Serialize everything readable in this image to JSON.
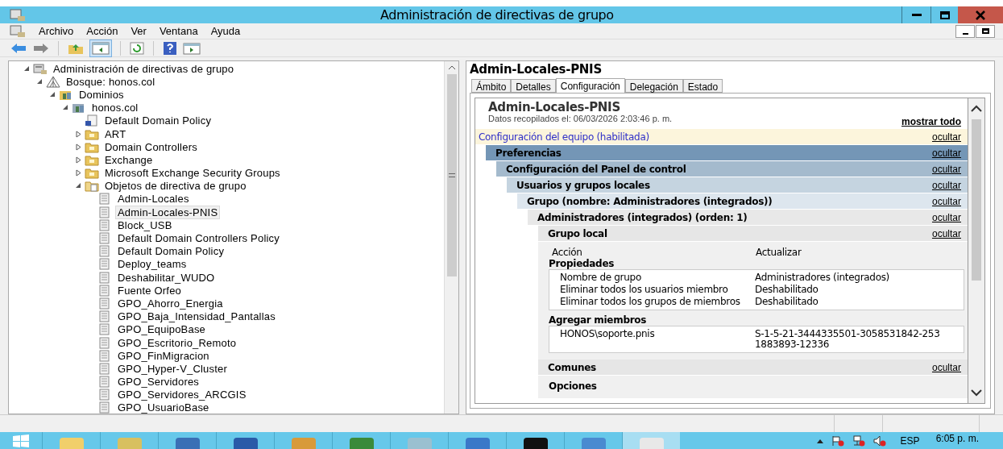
{
  "window": {
    "title": "Administración de directivas de grupo"
  },
  "menu": [
    "Archivo",
    "Acción",
    "Ver",
    "Ventana",
    "Ayuda"
  ],
  "toolbar": [
    {
      "kind": "back"
    },
    {
      "kind": "forward"
    },
    {
      "kind": "sep"
    },
    {
      "kind": "up"
    },
    {
      "kind": "pane",
      "selected": true
    },
    {
      "kind": "sep"
    },
    {
      "kind": "refresh"
    },
    {
      "kind": "sep"
    },
    {
      "kind": "help"
    },
    {
      "kind": "view"
    }
  ],
  "tree": [
    {
      "label": "Administración de directivas de grupo",
      "kind": "console",
      "expanded": true,
      "children": [
        {
          "label": "Bosque: honos.col",
          "kind": "forest",
          "expanded": true,
          "children": [
            {
              "label": "Dominios",
              "kind": "domains",
              "expanded": true,
              "children": [
                {
                  "label": "honos.col",
                  "kind": "domain",
                  "expanded": true,
                  "children": [
                    {
                      "label": "Default Domain Policy",
                      "kind": "link"
                    },
                    {
                      "label": "ART",
                      "kind": "ou",
                      "expanded": false
                    },
                    {
                      "label": "Domain Controllers",
                      "kind": "ou",
                      "expanded": false
                    },
                    {
                      "label": "Exchange",
                      "kind": "ou",
                      "expanded": false
                    },
                    {
                      "label": "Microsoft Exchange Security Groups",
                      "kind": "ou",
                      "expanded": false
                    },
                    {
                      "label": "Objetos de directiva de grupo",
                      "kind": "gpofolder",
                      "expanded": true,
                      "children": [
                        {
                          "label": "Admin-Locales",
                          "kind": "gpo",
                          "selected": false
                        },
                        {
                          "label": "Admin-Locales-PNIS",
                          "kind": "gpo",
                          "selected": true
                        },
                        {
                          "label": "Block_USB",
                          "kind": "gpo",
                          "selected": false
                        },
                        {
                          "label": "Default Domain Controllers Policy",
                          "kind": "gpo",
                          "selected": false
                        },
                        {
                          "label": "Default Domain Policy",
                          "kind": "gpo",
                          "selected": false
                        },
                        {
                          "label": "Deploy_teams",
                          "kind": "gpo",
                          "selected": false
                        },
                        {
                          "label": "Deshabilitar_WUDO",
                          "kind": "gpo",
                          "selected": false
                        },
                        {
                          "label": "Fuente Orfeo",
                          "kind": "gpo",
                          "selected": false
                        },
                        {
                          "label": "GPO_Ahorro_Energia",
                          "kind": "gpo",
                          "selected": false
                        },
                        {
                          "label": "GPO_Baja_Intensidad_Pantallas",
                          "kind": "gpo",
                          "selected": false
                        },
                        {
                          "label": "GPO_EquipoBase",
                          "kind": "gpo",
                          "selected": false
                        },
                        {
                          "label": "GPO_Escritorio_Remoto",
                          "kind": "gpo",
                          "selected": false
                        },
                        {
                          "label": "GPO_FinMigracion",
                          "kind": "gpo",
                          "selected": false
                        },
                        {
                          "label": "GPO_Hyper-V_Cluster",
                          "kind": "gpo",
                          "selected": false
                        },
                        {
                          "label": "GPO_Servidores",
                          "kind": "gpo",
                          "selected": false
                        },
                        {
                          "label": "GPO_Servidores_ARCGIS",
                          "kind": "gpo",
                          "selected": false
                        },
                        {
                          "label": "GPO_UsuarioBase",
                          "kind": "gpo",
                          "selected": false
                        }
                      ]
                    }
                  ]
                }
              ]
            }
          ]
        }
      ]
    }
  ],
  "details": {
    "title": "Admin-Locales-PNIS",
    "tabs": [
      {
        "label": "Ámbito",
        "selected": false
      },
      {
        "label": "Detalles",
        "selected": false
      },
      {
        "label": "Configuración",
        "selected": true
      },
      {
        "label": "Delegación",
        "selected": false
      },
      {
        "label": "Estado",
        "selected": false
      }
    ],
    "report": {
      "title": "Admin-Locales-PNIS",
      "collected": "Datos recopilados el: 06/03/2026 2:03:46 p. m.",
      "show_all": "mostrar todo",
      "sections": [
        {
          "title": "Configuración del equipo (habilitada)",
          "action": "ocultar",
          "children": [
            {
              "title": "Preferencias",
              "action": "ocultar",
              "children": [
                {
                  "title": "Configuración del Panel de control",
                  "action": "ocultar",
                  "children": [
                    {
                      "title": "Usuarios y grupos locales",
                      "action": "ocultar",
                      "children": [
                        {
                          "title": "Grupo (nombre: Administradores (integrados))",
                          "action": "ocultar",
                          "children": [
                            {
                              "title": "Administradores (integrados) (orden: 1)",
                              "action": "ocultar",
                              "children": [
                                {
                                  "title": "Grupo local",
                                  "action": "ocultar",
                                  "body": {
                                    "action_label": "Acción",
                                    "action_value": "Actualizar",
                                    "groups": [
                                      {
                                        "title": "Propiedades",
                                        "rows": [
                                          [
                                            "Nombre de grupo",
                                            "Administradores (integrados)"
                                          ],
                                          [
                                            "Eliminar todos los usuarios miembro",
                                            "Deshabilitado"
                                          ],
                                          [
                                            "Eliminar todos los grupos de miembros",
                                            "Deshabilitado"
                                          ]
                                        ]
                                      },
                                      {
                                        "title": "Agregar miembros",
                                        "rows": [
                                          [
                                            "HONOS\\soporte.pnis",
                                            "S-1-5-21-3444335501-3058531842-2531883893-12336"
                                          ]
                                        ]
                                      }
                                    ]
                                  }
                                },
                                {
                                  "title": "Comunes",
                                  "action": "ocultar",
                                  "body": {
                                    "groups": [
                                      {
                                        "title": "Opciones"
                                      }
                                    ]
                                  }
                                }
                              ]
                            }
                          ]
                        }
                      ]
                    }
                  ]
                }
              ]
            }
          ]
        }
      ]
    }
  },
  "taskbar": {
    "apps": [
      {
        "kind": "explorer"
      },
      {
        "kind": "files"
      },
      {
        "kind": "server"
      },
      {
        "kind": "powershell"
      },
      {
        "kind": "tools"
      },
      {
        "kind": "network"
      },
      {
        "kind": "notepad"
      },
      {
        "kind": "dashboard"
      },
      {
        "kind": "cmd"
      },
      {
        "kind": "panel"
      },
      {
        "kind": "gpm"
      }
    ],
    "language": "ESP",
    "time": "6:05 p. m."
  }
}
